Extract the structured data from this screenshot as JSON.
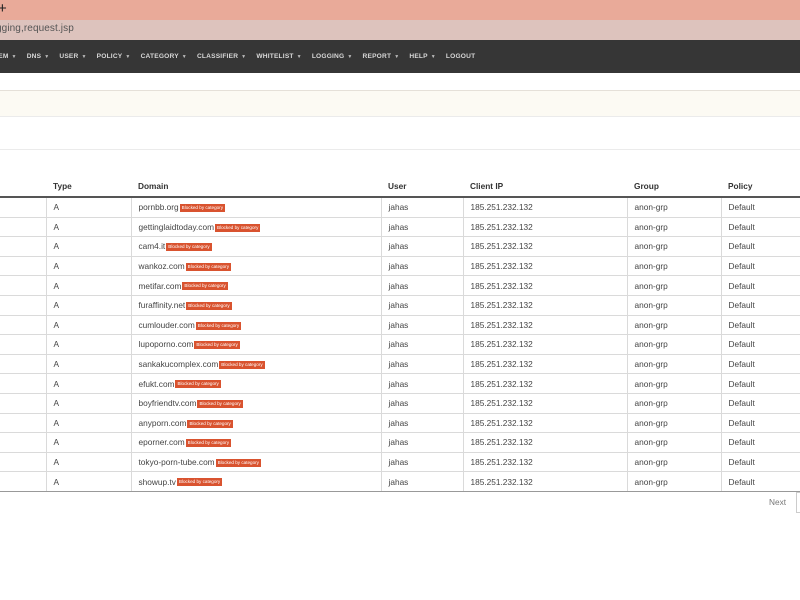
{
  "browser": {
    "new_tab_glyph": "+",
    "url": "gging,request.jsp"
  },
  "nav": {
    "items": [
      {
        "label": "TEM",
        "caret": "▼"
      },
      {
        "label": "DNS",
        "caret": "▼"
      },
      {
        "label": "USER",
        "caret": "▼"
      },
      {
        "label": "POLICY",
        "caret": "▼"
      },
      {
        "label": "CATEGORY",
        "caret": "▼"
      },
      {
        "label": "CLASSIFIER",
        "caret": "▼"
      },
      {
        "label": "WHITELIST",
        "caret": "▼"
      },
      {
        "label": "LOGGING",
        "caret": "▼"
      },
      {
        "label": "REPORT",
        "caret": "▼"
      },
      {
        "label": "HELP",
        "caret": "▼"
      },
      {
        "label": "LOGOUT",
        "caret": ""
      }
    ]
  },
  "table": {
    "headers": {
      "type": "Type",
      "domain": "Domain",
      "user": "User",
      "client_ip": "Client IP",
      "group": "Group",
      "policy": "Policy"
    },
    "badge_color": "#d9532f",
    "rows": [
      {
        "type": "A",
        "domain": "pornbb.org",
        "badge": "Blocked by category",
        "user": "jahas",
        "client_ip": "185.251.232.132",
        "group": "anon-grp",
        "policy": "Default"
      },
      {
        "type": "A",
        "domain": "gettinglaidtoday.com",
        "badge": "Blocked by category",
        "user": "jahas",
        "client_ip": "185.251.232.132",
        "group": "anon-grp",
        "policy": "Default"
      },
      {
        "type": "A",
        "domain": "cam4.it",
        "badge": "Blocked by category",
        "user": "jahas",
        "client_ip": "185.251.232.132",
        "group": "anon-grp",
        "policy": "Default"
      },
      {
        "type": "A",
        "domain": "wankoz.com",
        "badge": "Blocked by category",
        "user": "jahas",
        "client_ip": "185.251.232.132",
        "group": "anon-grp",
        "policy": "Default"
      },
      {
        "type": "A",
        "domain": "metifar.com",
        "badge": "Blocked by category",
        "user": "jahas",
        "client_ip": "185.251.232.132",
        "group": "anon-grp",
        "policy": "Default"
      },
      {
        "type": "A",
        "domain": "furaffinity.net",
        "badge": "Blocked by category",
        "user": "jahas",
        "client_ip": "185.251.232.132",
        "group": "anon-grp",
        "policy": "Default"
      },
      {
        "type": "A",
        "domain": "cumlouder.com",
        "badge": "Blocked by category",
        "user": "jahas",
        "client_ip": "185.251.232.132",
        "group": "anon-grp",
        "policy": "Default"
      },
      {
        "type": "A",
        "domain": "lupoporno.com",
        "badge": "Blocked by category",
        "user": "jahas",
        "client_ip": "185.251.232.132",
        "group": "anon-grp",
        "policy": "Default"
      },
      {
        "type": "A",
        "domain": "sankakucomplex.com",
        "badge": "Blocked by category",
        "user": "jahas",
        "client_ip": "185.251.232.132",
        "group": "anon-grp",
        "policy": "Default"
      },
      {
        "type": "A",
        "domain": "efukt.com",
        "badge": "Blocked by category",
        "user": "jahas",
        "client_ip": "185.251.232.132",
        "group": "anon-grp",
        "policy": "Default"
      },
      {
        "type": "A",
        "domain": "boyfriendtv.com",
        "badge": "Blocked by category",
        "user": "jahas",
        "client_ip": "185.251.232.132",
        "group": "anon-grp",
        "policy": "Default"
      },
      {
        "type": "A",
        "domain": "anyporn.com",
        "badge": "Blocked by category",
        "user": "jahas",
        "client_ip": "185.251.232.132",
        "group": "anon-grp",
        "policy": "Default"
      },
      {
        "type": "A",
        "domain": "eporner.com",
        "badge": "Blocked by category",
        "user": "jahas",
        "client_ip": "185.251.232.132",
        "group": "anon-grp",
        "policy": "Default"
      },
      {
        "type": "A",
        "domain": "tokyo-porn-tube.com",
        "badge": "Blocked by category",
        "user": "jahas",
        "client_ip": "185.251.232.132",
        "group": "anon-grp",
        "policy": "Default"
      },
      {
        "type": "A",
        "domain": "showup.tv",
        "badge": "Blocked by category",
        "user": "jahas",
        "client_ip": "185.251.232.132",
        "group": "anon-grp",
        "policy": "Default"
      }
    ]
  },
  "pagination": {
    "next_label": "Next"
  }
}
